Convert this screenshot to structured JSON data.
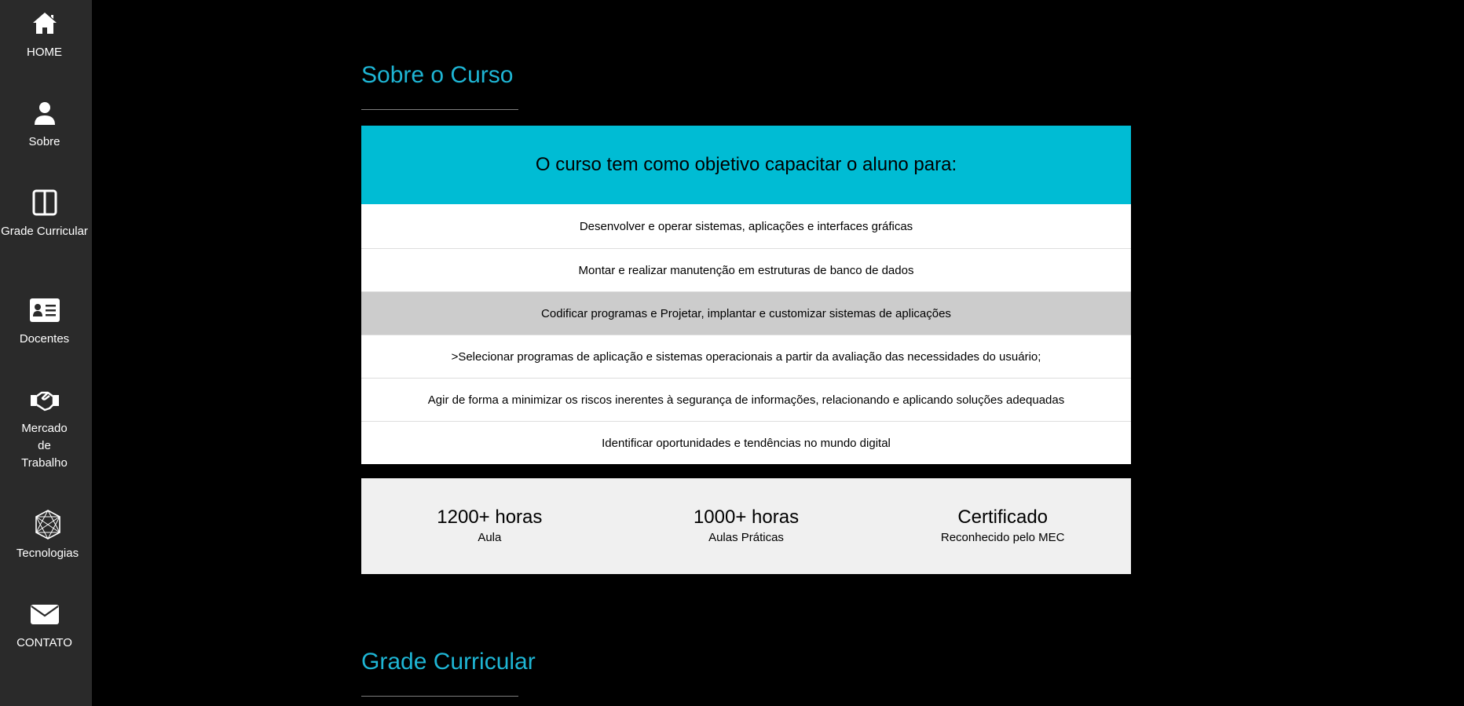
{
  "sidebar": {
    "items": [
      {
        "label": "HOME",
        "icon": "home-icon"
      },
      {
        "label": "Sobre",
        "icon": "user-icon"
      },
      {
        "label": "Grade Curricular",
        "icon": "book-columns-icon"
      },
      {
        "label": "Docentes",
        "icon": "id-card-icon"
      },
      {
        "label": "Mercado de Trabalho",
        "icon": "handshake-icon"
      },
      {
        "label": "Tecnologias",
        "icon": "network-polygon-icon"
      },
      {
        "label": "CONTATO",
        "icon": "envelope-icon"
      }
    ]
  },
  "about": {
    "title": "Sobre o Curso",
    "objective_header": "O curso tem como objetivo capacitar o aluno para:",
    "objectives": [
      "Desenvolver e operar sistemas, aplicações e interfaces gráficas",
      "Montar e realizar manutenção em estruturas de banco de dados",
      "Codificar programas e Projetar, implantar e customizar sistemas de aplicações",
      ">Selecionar programas de aplicação e sistemas operacionais a partir da avaliação das necessidades do usuário;",
      "Agir de forma a minimizar os riscos inerentes à segurança de informações, relacionando e aplicando soluções adequadas",
      "Identificar oportunidades e tendências no mundo digital"
    ],
    "stats": [
      {
        "value": "1200+ horas",
        "label": "Aula"
      },
      {
        "value": "1000+ horas",
        "label": "Aulas Práticas"
      },
      {
        "value": "Certificado",
        "label": "Reconhecido pelo MEC"
      }
    ]
  },
  "curriculum": {
    "title": "Grade Curricular"
  },
  "colors": {
    "accent": "#1eb5d4",
    "header_bg": "#00bcd4",
    "sidebar_bg": "#2a2a2a",
    "highlight_row": "#cccccc",
    "stats_bg": "#f0f0f0"
  }
}
